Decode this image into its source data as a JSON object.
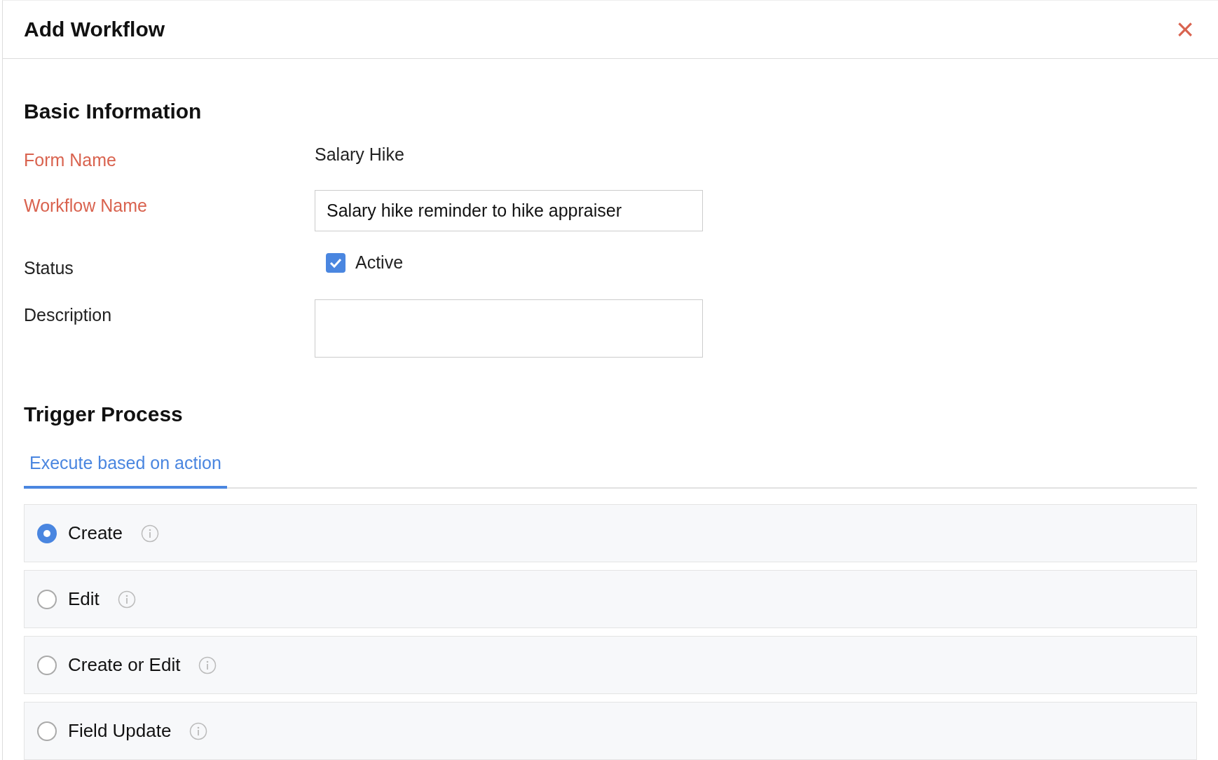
{
  "dialog": {
    "title": "Add Workflow",
    "close_icon": "×"
  },
  "basic_information": {
    "heading": "Basic Information",
    "fields": [
      {
        "kind": "static",
        "label": "Form Name",
        "required": true,
        "value": "Salary Hike"
      },
      {
        "kind": "input",
        "label": "Workflow Name",
        "required": true,
        "value": "Salary hike reminder to hike appraiser"
      },
      {
        "kind": "checkbox",
        "label": "Status",
        "required": false,
        "option": "Active",
        "checked": true
      },
      {
        "kind": "textarea",
        "label": "Description",
        "required": false
      }
    ]
  },
  "trigger_process": {
    "heading": "Trigger Process",
    "tabs": [
      {
        "label": "Execute based on action",
        "selected": true
      }
    ],
    "options": [
      {
        "label": "Create",
        "selected": true
      },
      {
        "label": "Edit",
        "selected": false
      },
      {
        "label": "Create or Edit",
        "selected": false
      },
      {
        "label": "Field Update",
        "selected": false
      }
    ]
  }
}
